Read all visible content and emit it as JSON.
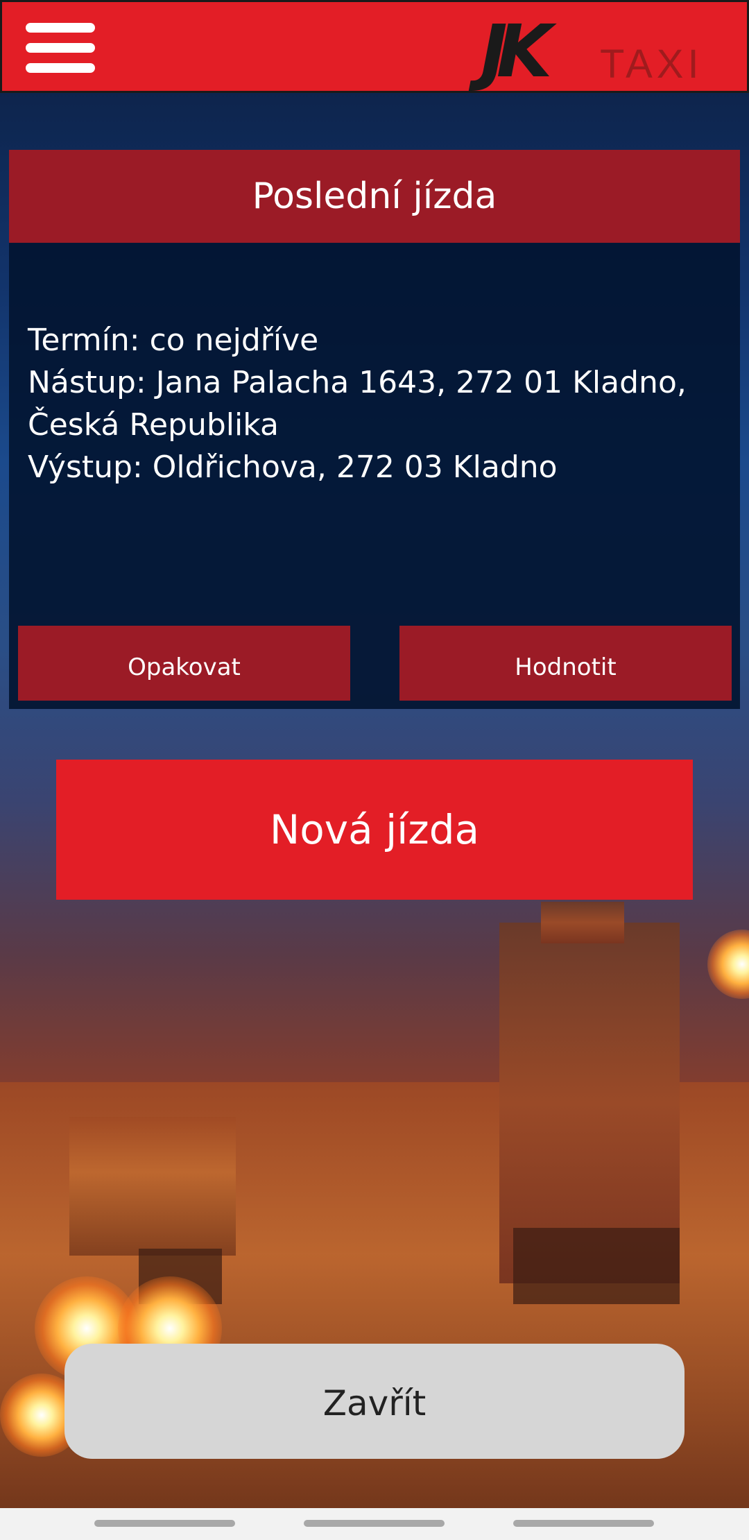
{
  "header": {
    "menu_icon": "hamburger-menu-icon",
    "logo": {
      "brand": "JK",
      "suffix": "TAXI"
    }
  },
  "last_ride": {
    "title": "Poslední jízda",
    "details": {
      "time_line": "Termín: co nejdříve",
      "pickup_line_1": "Nástup: Jana Palacha 1643, 272 01 Kladno,",
      "pickup_line_2": "Česká Republika",
      "dropoff_line": "Výstup: Oldřichova, 272 03 Kladno"
    },
    "repeat_label": "Opakovat",
    "rate_label": "Hodnotit"
  },
  "new_ride_label": "Nová jízda",
  "close_label": "Zavřít",
  "colors": {
    "header_red": "#e31e26",
    "card_red": "#9b1b26",
    "card_background": "#021430",
    "close_gray": "#d6d6d6"
  }
}
